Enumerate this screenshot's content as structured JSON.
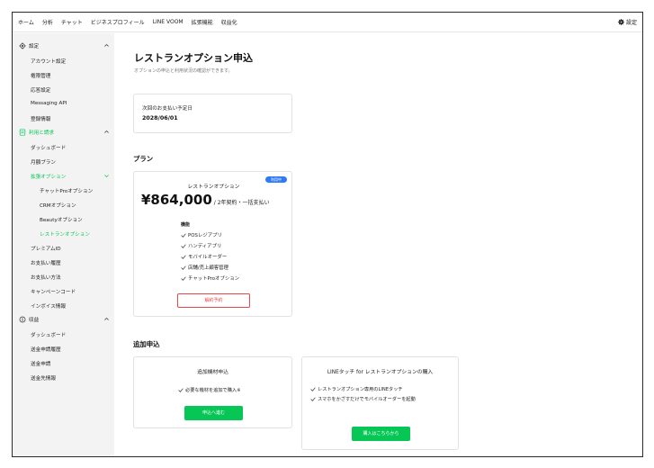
{
  "topnav": {
    "items": [
      "ホーム",
      "分析",
      "チャット",
      "ビジネスプロフィール",
      "LINE VOOM",
      "拡張機能",
      "収益化"
    ],
    "settings_label": "設定"
  },
  "sidebar": {
    "settings_section": "設定",
    "settings_items": [
      "アカウント設定",
      "権限管理",
      "応答設定",
      "Messaging API",
      "登録情報"
    ],
    "billing_section": "利用と請求",
    "billing_items": [
      "ダッシュボード",
      "月額プラン",
      "拡張オプション"
    ],
    "option_items": [
      "チャットProオプション",
      "CRMオプション",
      "Beautyオプション",
      "レストランオプション"
    ],
    "billing_items2": [
      "プレミアムID",
      "お支払い履歴",
      "お支払い方法",
      "キャンペーンコード",
      "インボイス情報"
    ],
    "revenue_section": "収益",
    "revenue_items": [
      "ダッシュボード",
      "送金申請履歴",
      "送金申請",
      "送金先情報"
    ]
  },
  "main": {
    "title": "レストランオプション申込",
    "description": "オプションの申込と利用状況の確認ができます。",
    "next_payment_label": "次回のお支払い予定日",
    "next_payment_date": "2028/06/01",
    "plan_heading": "プラン",
    "plan": {
      "name": "レストランオプション",
      "badge": "利用中",
      "price": "¥864,000",
      "price_suffix": "/ 2年契約・一括支払い",
      "features_title": "機能",
      "features": [
        "POSレジアプリ",
        "ハンディアプリ",
        "モバイルオーダー",
        "店舗/売上顧客管理",
        "チャットProオプション"
      ],
      "cancel_label": "解約予約"
    },
    "additional_heading": "追加申込",
    "addon1": {
      "title": "追加機材申込",
      "line": "必要な機材を追加で購入※",
      "button": "申込へ進む"
    },
    "addon2": {
      "title": "LINEタッチ for レストランオプションの購入",
      "lines": [
        "レストランオプション専用のLINEタッチ",
        "スマホをかざすだけでモバイルオーダーを起動"
      ],
      "button": "購入はこちらから"
    }
  },
  "colors": {
    "accent": "#06c755",
    "badge": "#2f7bf6",
    "danger": "#e8474a"
  }
}
